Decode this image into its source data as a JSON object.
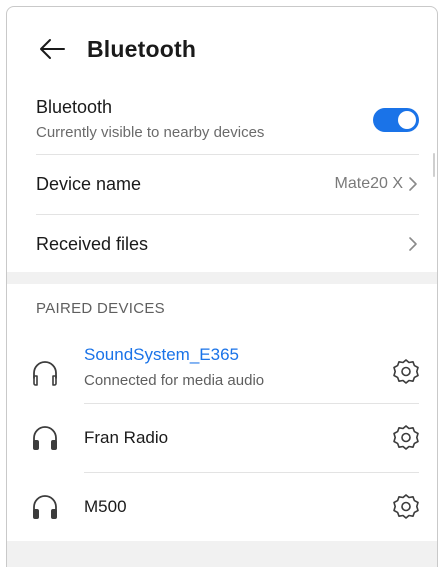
{
  "header": {
    "title": "Bluetooth"
  },
  "bluetooth": {
    "label": "Bluetooth",
    "subtitle": "Currently visible to nearby devices",
    "enabled": true
  },
  "device_name": {
    "label": "Device name",
    "value": "Mate20 X"
  },
  "received_files": {
    "label": "Received files"
  },
  "paired": {
    "section_title": "PAIRED DEVICES",
    "devices": [
      {
        "name": "SoundSystem_E365",
        "status": "Connected for media audio",
        "icon": "headphones-outline-icon"
      },
      {
        "name": "Fran Radio",
        "icon": "headphones-filled-icon"
      },
      {
        "name": "M500",
        "icon": "headphones-filled-icon"
      }
    ]
  },
  "colors": {
    "accent": "#1a73e8",
    "text": "#1a1a1a",
    "secondary": "#6b6b6b",
    "band": "#f1f1f1"
  }
}
